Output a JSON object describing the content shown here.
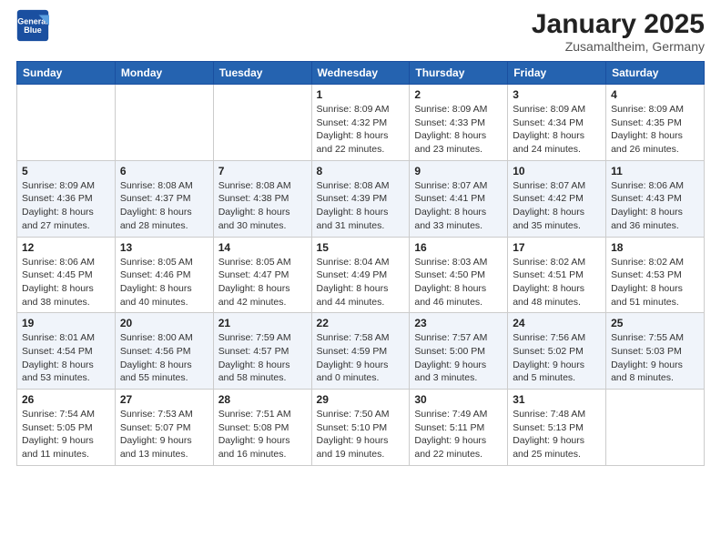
{
  "header": {
    "logo_line1": "General",
    "logo_line2": "Blue",
    "month": "January 2025",
    "location": "Zusamaltheim, Germany"
  },
  "weekdays": [
    "Sunday",
    "Monday",
    "Tuesday",
    "Wednesday",
    "Thursday",
    "Friday",
    "Saturday"
  ],
  "weeks": [
    [
      {
        "day": "",
        "info": ""
      },
      {
        "day": "",
        "info": ""
      },
      {
        "day": "",
        "info": ""
      },
      {
        "day": "1",
        "info": "Sunrise: 8:09 AM\nSunset: 4:32 PM\nDaylight: 8 hours\nand 22 minutes."
      },
      {
        "day": "2",
        "info": "Sunrise: 8:09 AM\nSunset: 4:33 PM\nDaylight: 8 hours\nand 23 minutes."
      },
      {
        "day": "3",
        "info": "Sunrise: 8:09 AM\nSunset: 4:34 PM\nDaylight: 8 hours\nand 24 minutes."
      },
      {
        "day": "4",
        "info": "Sunrise: 8:09 AM\nSunset: 4:35 PM\nDaylight: 8 hours\nand 26 minutes."
      }
    ],
    [
      {
        "day": "5",
        "info": "Sunrise: 8:09 AM\nSunset: 4:36 PM\nDaylight: 8 hours\nand 27 minutes."
      },
      {
        "day": "6",
        "info": "Sunrise: 8:08 AM\nSunset: 4:37 PM\nDaylight: 8 hours\nand 28 minutes."
      },
      {
        "day": "7",
        "info": "Sunrise: 8:08 AM\nSunset: 4:38 PM\nDaylight: 8 hours\nand 30 minutes."
      },
      {
        "day": "8",
        "info": "Sunrise: 8:08 AM\nSunset: 4:39 PM\nDaylight: 8 hours\nand 31 minutes."
      },
      {
        "day": "9",
        "info": "Sunrise: 8:07 AM\nSunset: 4:41 PM\nDaylight: 8 hours\nand 33 minutes."
      },
      {
        "day": "10",
        "info": "Sunrise: 8:07 AM\nSunset: 4:42 PM\nDaylight: 8 hours\nand 35 minutes."
      },
      {
        "day": "11",
        "info": "Sunrise: 8:06 AM\nSunset: 4:43 PM\nDaylight: 8 hours\nand 36 minutes."
      }
    ],
    [
      {
        "day": "12",
        "info": "Sunrise: 8:06 AM\nSunset: 4:45 PM\nDaylight: 8 hours\nand 38 minutes."
      },
      {
        "day": "13",
        "info": "Sunrise: 8:05 AM\nSunset: 4:46 PM\nDaylight: 8 hours\nand 40 minutes."
      },
      {
        "day": "14",
        "info": "Sunrise: 8:05 AM\nSunset: 4:47 PM\nDaylight: 8 hours\nand 42 minutes."
      },
      {
        "day": "15",
        "info": "Sunrise: 8:04 AM\nSunset: 4:49 PM\nDaylight: 8 hours\nand 44 minutes."
      },
      {
        "day": "16",
        "info": "Sunrise: 8:03 AM\nSunset: 4:50 PM\nDaylight: 8 hours\nand 46 minutes."
      },
      {
        "day": "17",
        "info": "Sunrise: 8:02 AM\nSunset: 4:51 PM\nDaylight: 8 hours\nand 48 minutes."
      },
      {
        "day": "18",
        "info": "Sunrise: 8:02 AM\nSunset: 4:53 PM\nDaylight: 8 hours\nand 51 minutes."
      }
    ],
    [
      {
        "day": "19",
        "info": "Sunrise: 8:01 AM\nSunset: 4:54 PM\nDaylight: 8 hours\nand 53 minutes."
      },
      {
        "day": "20",
        "info": "Sunrise: 8:00 AM\nSunset: 4:56 PM\nDaylight: 8 hours\nand 55 minutes."
      },
      {
        "day": "21",
        "info": "Sunrise: 7:59 AM\nSunset: 4:57 PM\nDaylight: 8 hours\nand 58 minutes."
      },
      {
        "day": "22",
        "info": "Sunrise: 7:58 AM\nSunset: 4:59 PM\nDaylight: 9 hours\nand 0 minutes."
      },
      {
        "day": "23",
        "info": "Sunrise: 7:57 AM\nSunset: 5:00 PM\nDaylight: 9 hours\nand 3 minutes."
      },
      {
        "day": "24",
        "info": "Sunrise: 7:56 AM\nSunset: 5:02 PM\nDaylight: 9 hours\nand 5 minutes."
      },
      {
        "day": "25",
        "info": "Sunrise: 7:55 AM\nSunset: 5:03 PM\nDaylight: 9 hours\nand 8 minutes."
      }
    ],
    [
      {
        "day": "26",
        "info": "Sunrise: 7:54 AM\nSunset: 5:05 PM\nDaylight: 9 hours\nand 11 minutes."
      },
      {
        "day": "27",
        "info": "Sunrise: 7:53 AM\nSunset: 5:07 PM\nDaylight: 9 hours\nand 13 minutes."
      },
      {
        "day": "28",
        "info": "Sunrise: 7:51 AM\nSunset: 5:08 PM\nDaylight: 9 hours\nand 16 minutes."
      },
      {
        "day": "29",
        "info": "Sunrise: 7:50 AM\nSunset: 5:10 PM\nDaylight: 9 hours\nand 19 minutes."
      },
      {
        "day": "30",
        "info": "Sunrise: 7:49 AM\nSunset: 5:11 PM\nDaylight: 9 hours\nand 22 minutes."
      },
      {
        "day": "31",
        "info": "Sunrise: 7:48 AM\nSunset: 5:13 PM\nDaylight: 9 hours\nand 25 minutes."
      },
      {
        "day": "",
        "info": ""
      }
    ]
  ]
}
